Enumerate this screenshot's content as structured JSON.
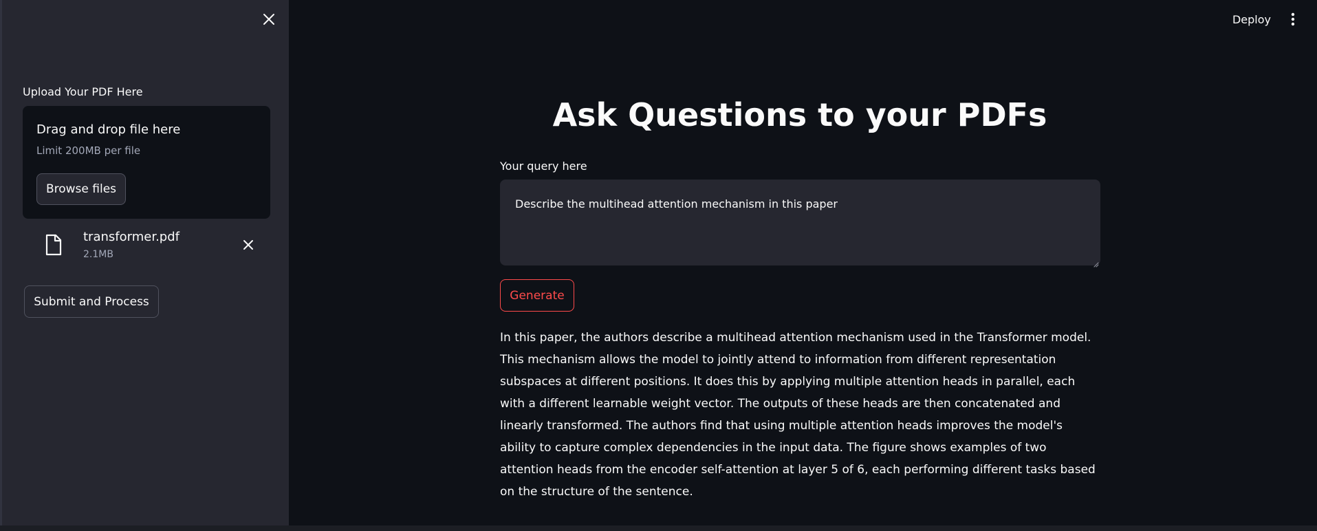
{
  "sidebar": {
    "upload_label": "Upload Your PDF Here",
    "dropzone": {
      "title": "Drag and drop file here",
      "limit": "Limit 200MB per file",
      "browse_label": "Browse files"
    },
    "file": {
      "name": "transformer.pdf",
      "size": "2.1MB"
    },
    "submit_label": "Submit and Process",
    "icons": {
      "close": "close-icon",
      "file": "file-icon",
      "remove": "close-icon"
    }
  },
  "header": {
    "deploy_label": "Deploy",
    "menu_icon": "kebab-menu-icon"
  },
  "main": {
    "title": "Ask Questions to your PDFs",
    "query_label": "Your query here",
    "query_value": "Describe the multihead attention mechanism in this paper",
    "generate_label": "Generate",
    "answer": "In this paper, the authors describe a multihead attention mechanism used in the Transformer model. This mechanism allows the model to jointly attend to information from different representation subspaces at different positions. It does this by applying multiple attention heads in parallel, each with a different learnable weight vector. The outputs of these heads are then concatenated and linearly transformed. The authors find that using multiple attention heads improves the model's ability to capture complex dependencies in the input data. The figure shows examples of two attention heads from the encoder self-attention at layer 5 of 6, each performing different tasks based on the structure of the sentence."
  },
  "colors": {
    "background": "#0e1117",
    "sidebar": "#262730",
    "accent": "#ff4b4b",
    "text": "#fafafa",
    "muted": "#a3a8b8"
  }
}
